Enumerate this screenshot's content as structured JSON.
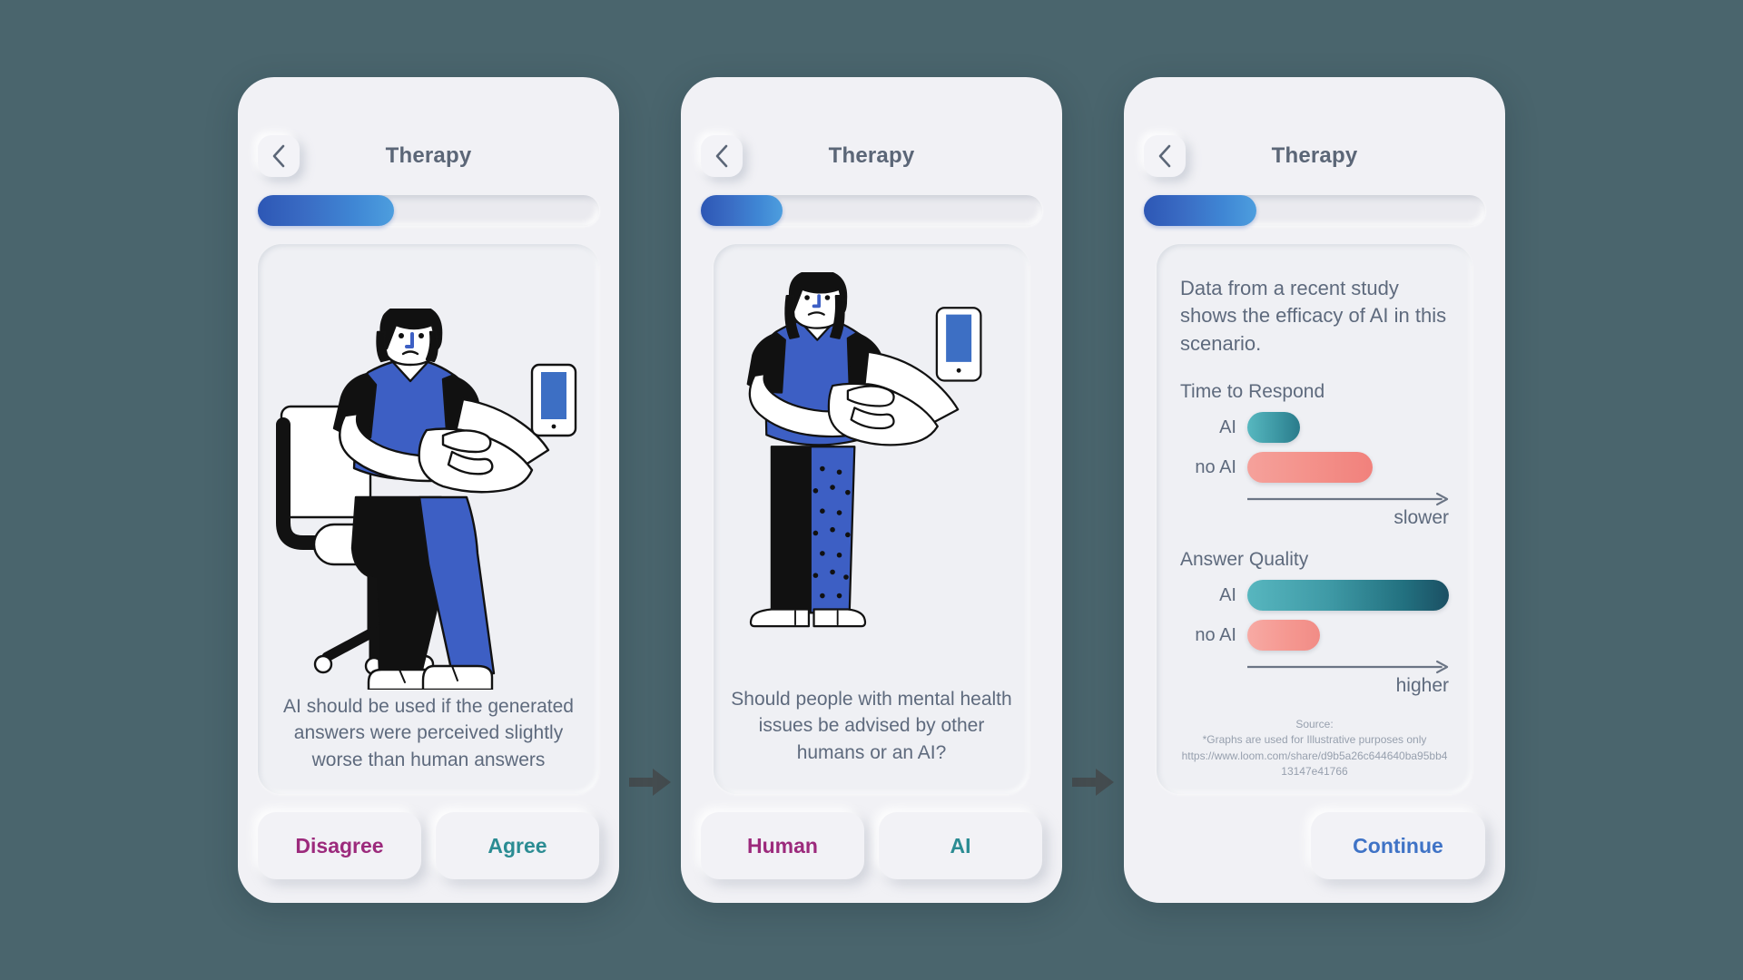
{
  "canvas": {
    "background_color": "#4a656d",
    "arrow_color": "#454d50"
  },
  "screens": [
    {
      "id": "screen-statement",
      "header": {
        "title": "Therapy",
        "back_icon": "chevron-left-icon"
      },
      "progress": {
        "percent": 40,
        "value_label": "40%"
      },
      "illustration": "person-seated-in-office-chair-holding-phone",
      "prompt": "AI should be used if the generated answers were perceived slightly worse than human answers",
      "buttons": [
        {
          "label": "Disagree",
          "color": "#9c2a7c",
          "name": "disagree-button"
        },
        {
          "label": "Agree",
          "color": "#2b8c93",
          "name": "agree-button"
        }
      ]
    },
    {
      "id": "screen-question",
      "header": {
        "title": "Therapy",
        "back_icon": "chevron-left-icon"
      },
      "progress": {
        "percent": 24,
        "value_label": "24%"
      },
      "illustration": "person-standing-holding-phone",
      "prompt": "Should people with mental health issues be advised by other humans or an AI?",
      "buttons": [
        {
          "label": "Human",
          "color": "#9c2a7c",
          "name": "human-button"
        },
        {
          "label": "AI",
          "color": "#2b8c93",
          "name": "ai-button"
        }
      ]
    },
    {
      "id": "screen-data",
      "header": {
        "title": "Therapy",
        "back_icon": "chevron-left-icon"
      },
      "progress": {
        "percent": 33,
        "value_label": "33%"
      },
      "intro": "Data from a recent study shows the efficacy of AI in this scenario.",
      "source": {
        "heading": "Source:",
        "note": "*Graphs are used for Illustrative purposes only",
        "url": "https://www.loom.com/share/d9b5a26c644640ba95bb413147e41766"
      },
      "buttons": [
        {
          "label": "Continue",
          "color": "#3f73c6",
          "name": "continue-button"
        }
      ]
    }
  ],
  "chart_data": [
    {
      "type": "bar",
      "orientation": "horizontal",
      "title": "Time to Respond",
      "categories": [
        "AI",
        "no AI"
      ],
      "values": [
        26,
        62
      ],
      "value_unit": "relative length (% of axis)",
      "axis_caption": "slower",
      "axis_direction": "right",
      "colors": [
        "#3f9aa6",
        "#f4938c"
      ],
      "xlabel": "",
      "ylabel": "",
      "grid": false,
      "legend": false
    },
    {
      "type": "bar",
      "orientation": "horizontal",
      "title": "Answer Quality",
      "categories": [
        "AI",
        "no AI"
      ],
      "values": [
        100,
        36
      ],
      "value_unit": "relative length (% of axis)",
      "axis_caption": "higher",
      "axis_direction": "right",
      "colors": [
        "#22707f",
        "#f59891"
      ],
      "xlabel": "",
      "ylabel": "",
      "grid": false,
      "legend": false
    }
  ]
}
